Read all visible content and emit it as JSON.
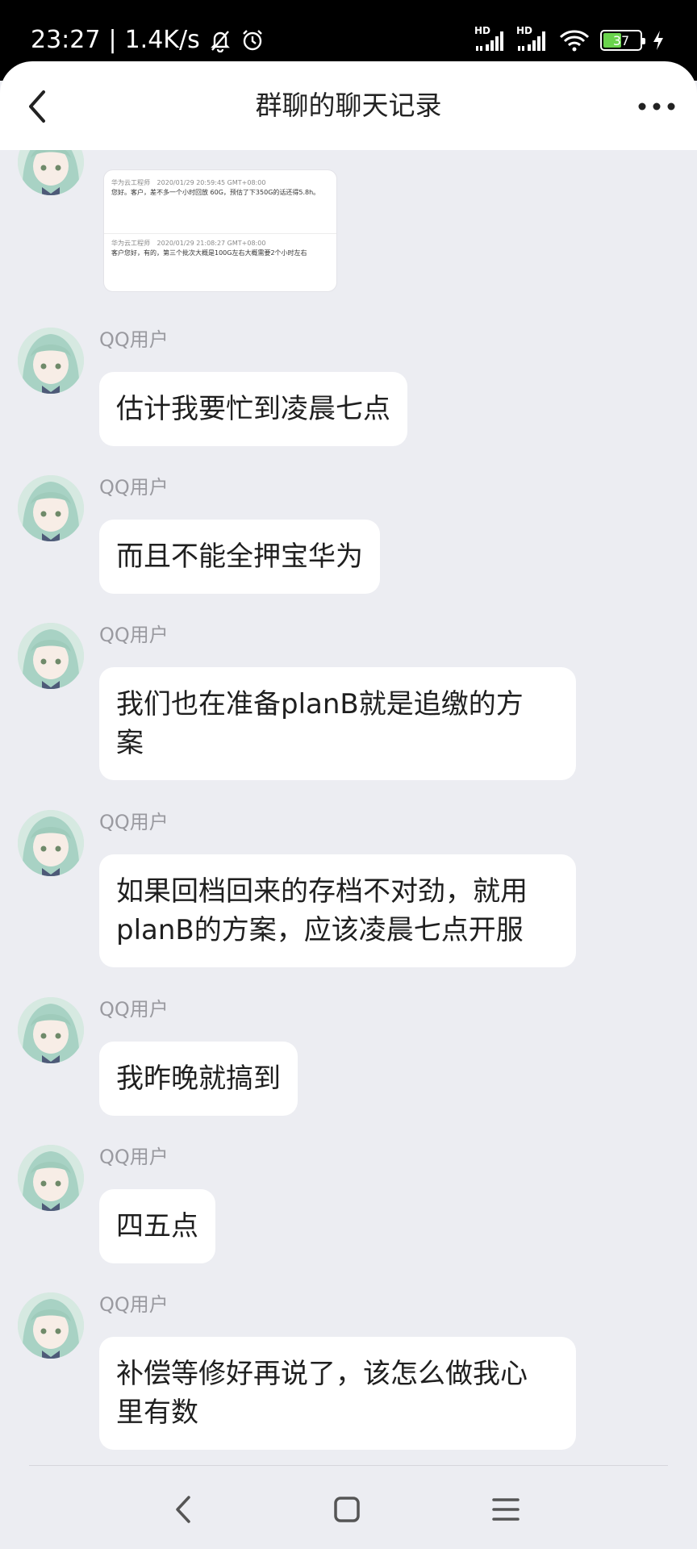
{
  "status_bar": {
    "time": "23:27",
    "separator": "|",
    "net_speed": "1.4K/s",
    "battery": "37",
    "signal_label_1": "HD",
    "signal_label_2": "HD"
  },
  "header": {
    "title": "群聊的聊天记录"
  },
  "image_message": {
    "entries": [
      {
        "sender": "华为云工程师",
        "time": "2020/01/29 20:59:45 GMT+08:00",
        "text": "您好。客户，差不多一个小时回放 60G，预估了下350G的话还得5.8h。"
      },
      {
        "sender": "华为云工程师",
        "time": "2020/01/29 21:08:27 GMT+08:00",
        "text": "客户您好，有的，第三个批次大概是100G左右大概需要2个小时左右"
      }
    ]
  },
  "messages": [
    {
      "sender": "QQ用户",
      "lines": [
        "估计我要忙到凌晨七点"
      ]
    },
    {
      "sender": "QQ用户",
      "lines": [
        "而且不能全押宝华为"
      ]
    },
    {
      "sender": "QQ用户",
      "lines": [
        "我们也在准备planB就是追缴的方",
        "案"
      ]
    },
    {
      "sender": "QQ用户",
      "lines": [
        "如果回档回来的存档不对劲，就用",
        "planB的方案，应该凌晨七点开服"
      ]
    },
    {
      "sender": "QQ用户",
      "lines": [
        "我昨晚就搞到"
      ]
    },
    {
      "sender": "QQ用户",
      "lines": [
        "四五点"
      ]
    },
    {
      "sender": "QQ用户",
      "lines": [
        "补偿等修好再说了，该怎么做我心",
        "里有数"
      ]
    }
  ],
  "icons": {
    "back": "chevron-left-icon",
    "more": "more-dots-icon",
    "mute": "bell-off-icon",
    "alarm": "alarm-icon",
    "wifi": "wifi-icon",
    "nav_back": "nav-back-icon",
    "nav_home": "nav-home-icon",
    "nav_menu": "nav-menu-icon"
  },
  "colors": {
    "background": "#ecedf2",
    "bubble": "#ffffff",
    "sender": "#9a9aa0",
    "battery_fill": "#6ad34d"
  }
}
